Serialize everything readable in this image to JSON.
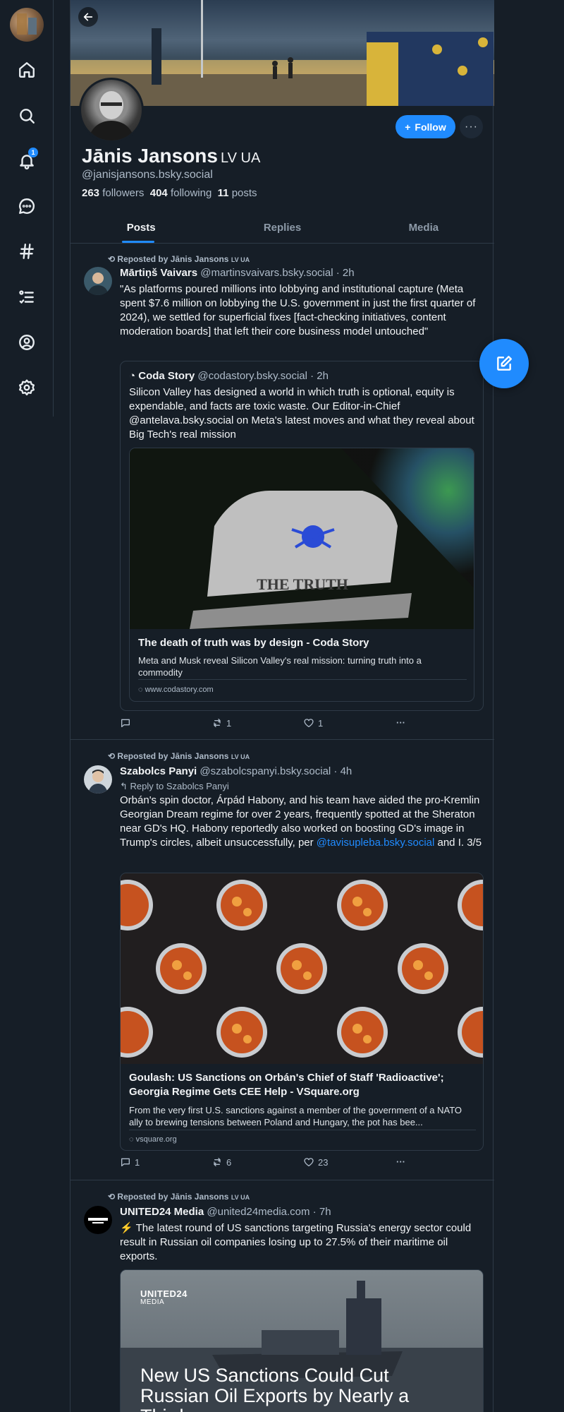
{
  "sidebar": {
    "items": [
      {
        "icon": "home-icon"
      },
      {
        "icon": "search-icon"
      },
      {
        "icon": "bell-icon",
        "badge": "1"
      },
      {
        "icon": "chat-icon"
      },
      {
        "icon": "hashtag-icon"
      },
      {
        "icon": "list-icon"
      },
      {
        "icon": "profile-icon"
      },
      {
        "icon": "settings-icon"
      }
    ]
  },
  "profile": {
    "display_name": "Jānis Jansons",
    "flags": "LV UA",
    "handle": "@janisjansons.bsky.social",
    "followers_count": "263",
    "followers_label": "followers",
    "following_count": "404",
    "following_label": "following",
    "posts_count": "11",
    "posts_label": "posts",
    "follow_label": "Follow"
  },
  "tabs": [
    {
      "label": "Posts",
      "active": true
    },
    {
      "label": "Replies",
      "active": false
    },
    {
      "label": "Media",
      "active": false
    }
  ],
  "posts": [
    {
      "repost_label": "Reposted by Jānis Jansons",
      "repost_flags": "LV UA",
      "author_name": "Mārtiņš Vaivars",
      "author_handle": "@martinsvaivars.bsky.social · 2h",
      "text": "\"As platforms poured millions into lobbying and institutional capture (Meta spent $7.6 million on lobbying the U.S. government in just the first quarter of 2024), we settled for superficial fixes [fact-checking initiatives, content moderation boards] that left their core business model untouched\"",
      "quote": {
        "author_name": "Coda Story",
        "author_handle": "@codastory.bsky.social · 2h",
        "text": "Silicon Valley has designed a world in which truth is optional, equity is expendable, and facts are toxic waste. Our Editor-in-Chief @antelava.bsky.social on Meta's latest moves and what they reveal about Big Tech's real mission",
        "card_title": "The death of truth was by design - Coda Story",
        "card_desc": "Meta and Musk reveal Silicon Valley's real mission: turning truth into a commodity",
        "card_domain": "www.codastory.com",
        "image_text": "THE TRUTH"
      },
      "replies": "",
      "reposts": "1",
      "likes": "1"
    },
    {
      "repost_label": "Reposted by Jānis Jansons",
      "repost_flags": "LV UA",
      "author_name": "Szabolcs Panyi",
      "author_handle": "@szabolcspanyi.bsky.social · 4h",
      "reply_to": "Reply to Szabolcs Panyi",
      "text_before": "Orbán's spin doctor, Árpád Habony, and his team have aided the pro-Kremlin Georgian Dream regime for over 2 years, frequently spotted at the Sheraton near GD's HQ. Habony reportedly also worked on boosting GD's image in Trump's circles, albeit unsuccessfully, per ",
      "text_link": "@tavisupleba.bsky.social",
      "text_after": " and I. 3/5",
      "card_title": "Goulash: US Sanctions on Orbán's Chief of Staff 'Radioactive'; Georgia Regime Gets CEE Help - VSquare.org",
      "card_desc": "From the very first U.S. sanctions against a member of the government of a NATO ally to brewing tensions between Poland and Hungary, the pot has bee...",
      "card_domain": "vsquare.org",
      "replies": "1",
      "reposts": "6",
      "likes": "23"
    },
    {
      "repost_label": "Reposted by Jānis Jansons",
      "repost_flags": "LV UA",
      "author_name": "UNITED24 Media",
      "author_handle": "@united24media.com · 7h",
      "text": "⚡ The latest round of US sanctions targeting Russia's energy sector could result in Russian oil companies losing up to 27.5% of their maritime oil exports.",
      "card_logo": "UNITED24",
      "card_logo_sub": "MEDIA",
      "card_headline": "New US Sanctions Could Cut Russian Oil Exports by Nearly a Third"
    }
  ],
  "colors": {
    "accent": "#208bfe",
    "background": "#161e27",
    "border": "#2e3a47",
    "muted_text": "#aebbc9"
  }
}
